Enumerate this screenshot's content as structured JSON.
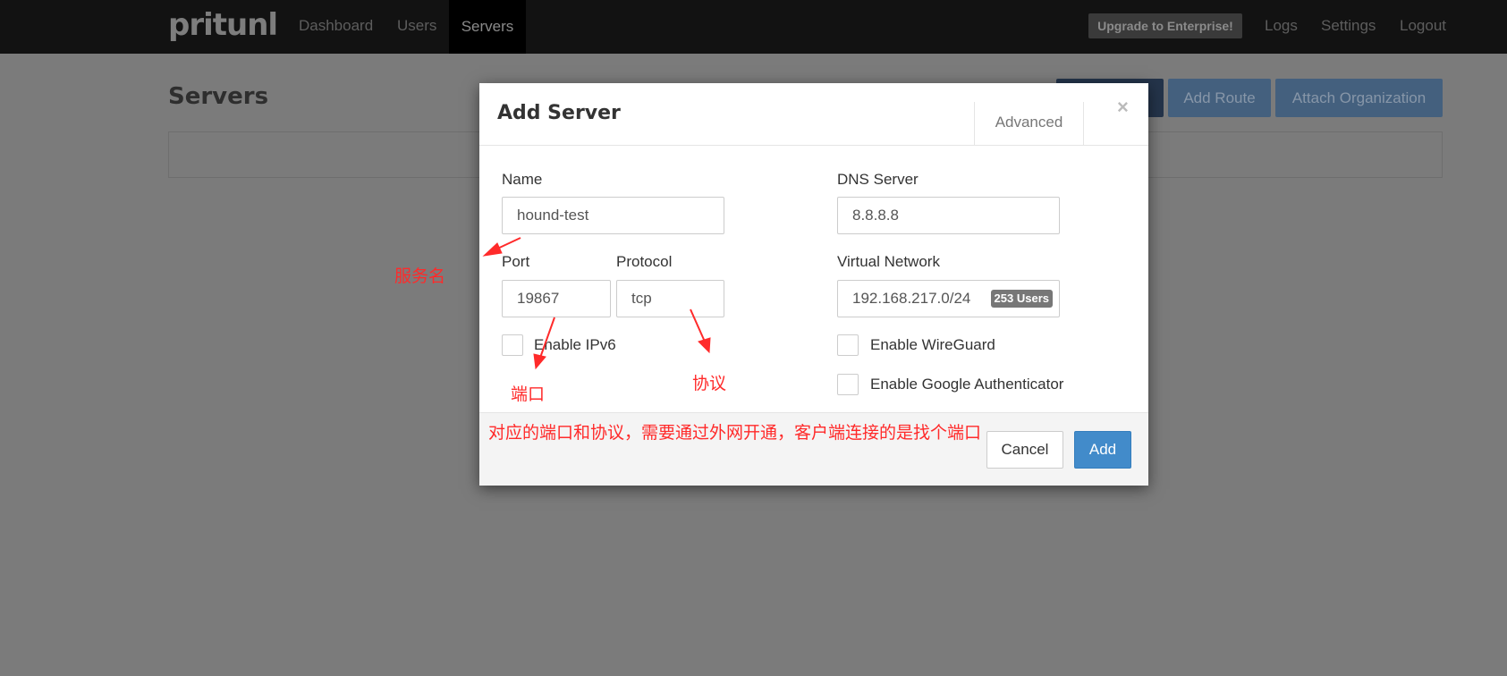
{
  "nav": {
    "logo": "pritunl",
    "dashboard": "Dashboard",
    "users": "Users",
    "servers": "Servers",
    "upgrade": "Upgrade to Enterprise!",
    "logs": "Logs",
    "settings": "Settings",
    "logout": "Logout"
  },
  "page": {
    "title": "Servers",
    "add_route": "Add Route",
    "attach_org": "Attach Organization"
  },
  "modal": {
    "title": "Add Server",
    "advanced": "Advanced",
    "close": "×",
    "name_label": "Name",
    "name_value": "hound-test",
    "dns_label": "DNS Server",
    "dns_value": "8.8.8.8",
    "port_label": "Port",
    "port_value": "19867",
    "protocol_label": "Protocol",
    "protocol_value": "tcp",
    "vnet_label": "Virtual Network",
    "vnet_value": "192.168.217.0/24",
    "vnet_badge": "253 Users",
    "ipv6": "Enable IPv6",
    "wireguard": "Enable WireGuard",
    "google_auth": "Enable Google Authenticator",
    "cancel": "Cancel",
    "add": "Add"
  },
  "annotations": {
    "server_name": "服务名",
    "port": "端口",
    "protocol": "协议",
    "note": "对应的端口和协议，需要通过外网开通，客户端连接的是找个端口"
  },
  "colors": {
    "primary": "#428bca",
    "annotation": "#ff2a2a"
  }
}
